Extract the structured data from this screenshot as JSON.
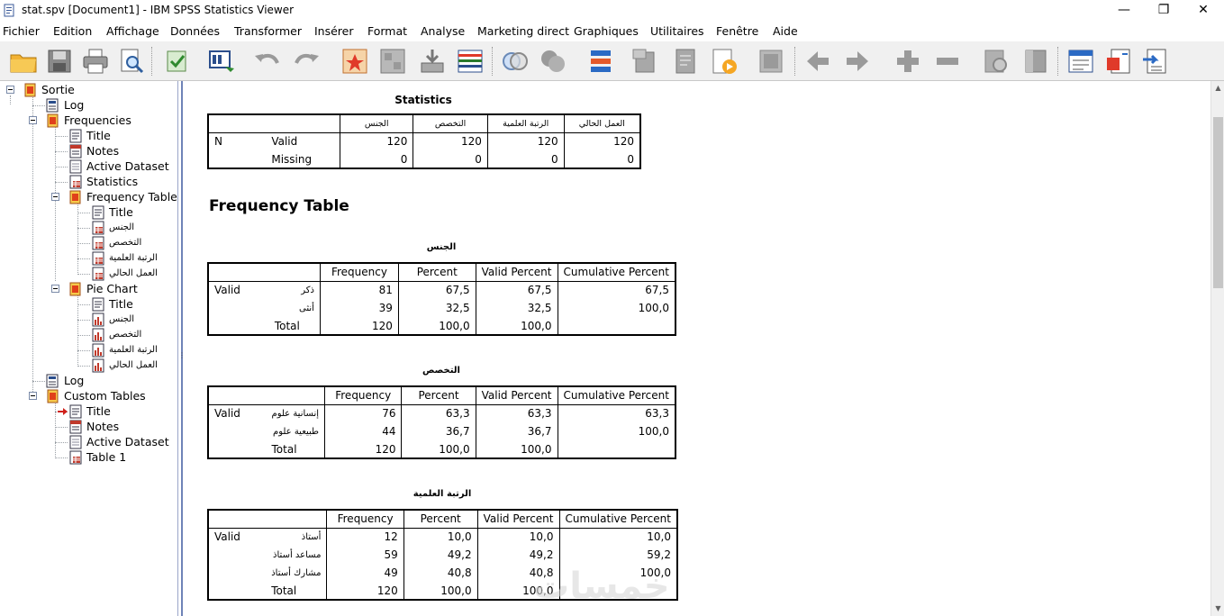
{
  "window": {
    "title": "stat.spv [Document1] - IBM SPSS Statistics Viewer",
    "minimize": "—",
    "restore": "❐",
    "close": "✕"
  },
  "menu": [
    "Fichier",
    "Edition",
    "Affichage",
    "Données",
    "Transformer",
    "Insérer",
    "Format",
    "Analyse",
    "Marketing direct",
    "Graphiques",
    "Utilitaires",
    "Fenêtre",
    "Aide"
  ],
  "outline": {
    "nodes": [
      "Sortie",
      "Log",
      "Frequencies",
      "Title",
      "Notes",
      "Active Dataset",
      "Statistics",
      "Frequency Table",
      "Title",
      "الجنس",
      "التخصص",
      "الرتبة العلمية",
      "العمل الحالي",
      "Pie Chart",
      "Title",
      "الجنس",
      "التخصص",
      "الرتبة العلمية",
      "العمل الحالي",
      "Log",
      "Custom Tables",
      "Title",
      "Notes",
      "Active Dataset",
      "Table 1"
    ]
  },
  "statistics": {
    "title": "Statistics",
    "headers": [
      "الجنس",
      "التخصص",
      "الرتبة العلمية",
      "العمل الحالي"
    ],
    "n_label": "N",
    "valid_label": "Valid",
    "missing_label": "Missing",
    "valid": [
      "120",
      "120",
      "120",
      "120"
    ],
    "missing": [
      "0",
      "0",
      "0",
      "0"
    ]
  },
  "frequency_heading": "Frequency Table",
  "freq_tables": [
    {
      "title": "الجنس",
      "headers": [
        "Frequency",
        "Percent",
        "Valid Percent",
        "Cumulative Percent"
      ],
      "valid_label": "Valid",
      "rows": [
        {
          "label": "ذكر",
          "freq": "81",
          "pct": "67,5",
          "vpct": "67,5",
          "cpct": "67,5"
        },
        {
          "label": "أنثى",
          "freq": "39",
          "pct": "32,5",
          "vpct": "32,5",
          "cpct": "100,0"
        },
        {
          "label": "Total",
          "freq": "120",
          "pct": "100,0",
          "vpct": "100,0",
          "cpct": ""
        }
      ]
    },
    {
      "title": "التخصص",
      "headers": [
        "Frequency",
        "Percent",
        "Valid Percent",
        "Cumulative Percent"
      ],
      "valid_label": "Valid",
      "rows": [
        {
          "label": "إنسانية علوم",
          "freq": "76",
          "pct": "63,3",
          "vpct": "63,3",
          "cpct": "63,3"
        },
        {
          "label": "طبيعية علوم",
          "freq": "44",
          "pct": "36,7",
          "vpct": "36,7",
          "cpct": "100,0"
        },
        {
          "label": "Total",
          "freq": "120",
          "pct": "100,0",
          "vpct": "100,0",
          "cpct": ""
        }
      ]
    },
    {
      "title": "الرتبة العلمية",
      "headers": [
        "Frequency",
        "Percent",
        "Valid Percent",
        "Cumulative Percent"
      ],
      "valid_label": "Valid",
      "rows": [
        {
          "label": "أستاذ",
          "freq": "12",
          "pct": "10,0",
          "vpct": "10,0",
          "cpct": "10,0"
        },
        {
          "label": "مساعد أستاذ",
          "freq": "59",
          "pct": "49,2",
          "vpct": "49,2",
          "cpct": "59,2"
        },
        {
          "label": "مشارك أستاذ",
          "freq": "49",
          "pct": "40,8",
          "vpct": "40,8",
          "cpct": "100,0"
        },
        {
          "label": "Total",
          "freq": "120",
          "pct": "100,0",
          "vpct": "100,0",
          "cpct": ""
        }
      ]
    }
  ],
  "watermark": "خمسات"
}
